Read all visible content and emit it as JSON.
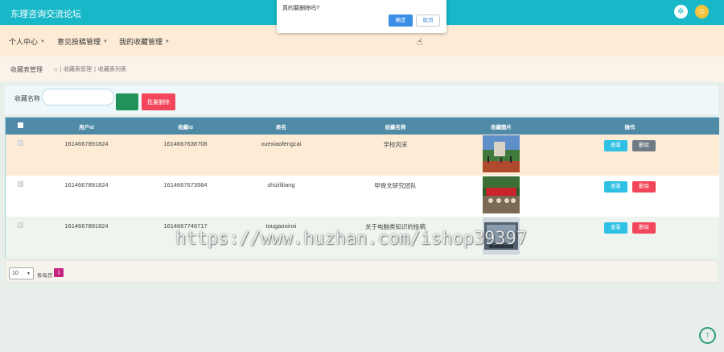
{
  "app": {
    "title": "东理咨询交流论坛"
  },
  "header_icons": {
    "settings": "settings-icon",
    "user": "user-avatar-icon"
  },
  "nav": {
    "items": [
      {
        "label": "个人中心"
      },
      {
        "label": "意见投稿管理"
      },
      {
        "label": "我的收藏管理"
      }
    ]
  },
  "breadcrumb": {
    "title": "收藏表管理",
    "path": [
      "收藏表管理",
      "收藏表列表"
    ]
  },
  "search": {
    "label": "收藏名称",
    "value": "",
    "placeholder": "",
    "search_button_label": "",
    "batch_delete_label": "批量删除"
  },
  "table": {
    "columns": [
      "用户id",
      "收藏id",
      "表名",
      "收藏名称",
      "收藏图片",
      "操作"
    ],
    "rows": [
      {
        "user_id": "1614667891824",
        "fav_id": "1614667638708",
        "table_name": "xuexiaofengcai",
        "fav_name": "学校风采",
        "view": "查看",
        "delete": "删除"
      },
      {
        "user_id": "1614667891824",
        "fav_id": "1614667673584",
        "table_name": "shizililiang",
        "fav_name": "甲骨文研究团队",
        "view": "查看",
        "delete": "删除"
      },
      {
        "user_id": "1614667891824",
        "fav_id": "1614667746717",
        "table_name": "tougaoxinxi",
        "fav_name": "关于电脑类知识的投稿",
        "view": "查看",
        "delete": "删除"
      }
    ]
  },
  "pager": {
    "page_size": "10",
    "per_page_label": "条每页",
    "current_page": "1"
  },
  "dialog": {
    "message": "真的要删除吗?",
    "ok_label": "确定",
    "cancel_label": "取消"
  },
  "watermark": "https://www.huzhan.com/ishop39397",
  "colors": {
    "topbar": "#18b8c9",
    "table_header": "#4f8aa7",
    "danger": "#f4465a",
    "info": "#2ec0e5",
    "search": "#20925a",
    "page_active": "#c4227f"
  }
}
